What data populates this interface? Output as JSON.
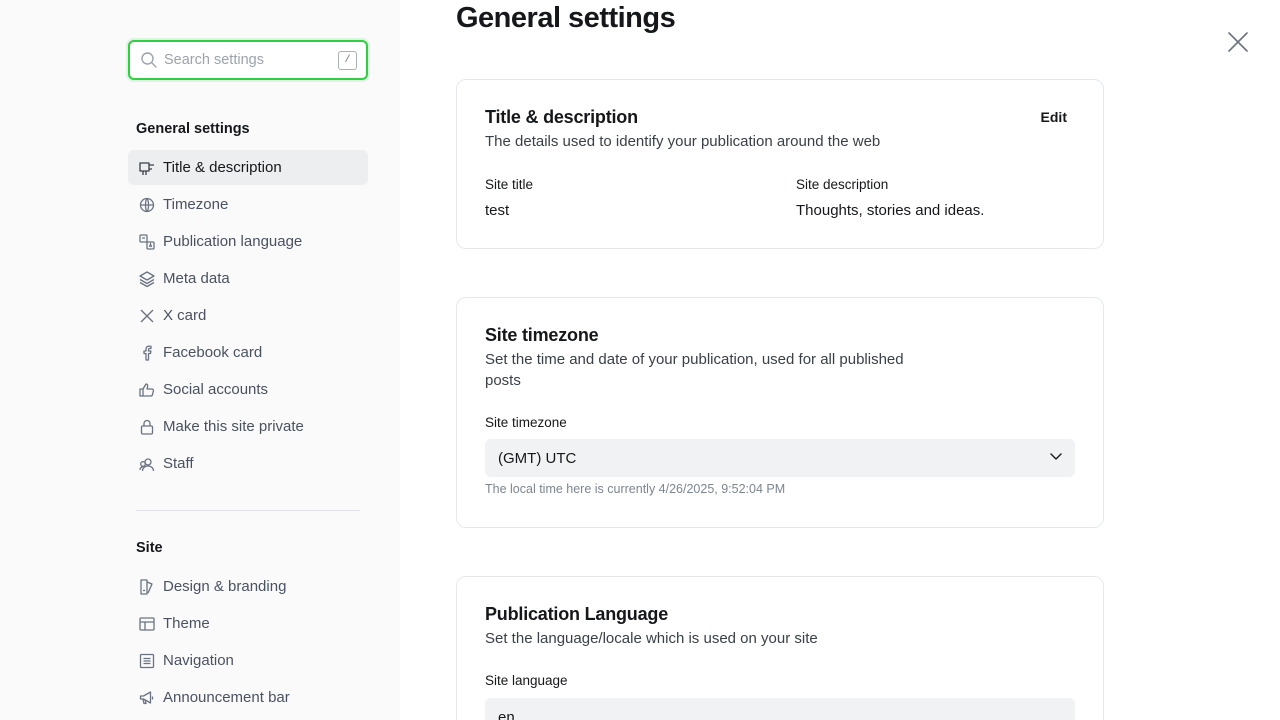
{
  "search": {
    "placeholder": "Search settings",
    "shortcut": "/"
  },
  "sidebar": {
    "general": {
      "title": "General settings",
      "items": [
        {
          "label": "Title & description",
          "icon": "title-icon",
          "active": true
        },
        {
          "label": "Timezone",
          "icon": "globe-icon"
        },
        {
          "label": "Publication language",
          "icon": "language-icon"
        },
        {
          "label": "Meta data",
          "icon": "layers-icon"
        },
        {
          "label": "X card",
          "icon": "x-logo-icon"
        },
        {
          "label": "Facebook card",
          "icon": "facebook-icon"
        },
        {
          "label": "Social accounts",
          "icon": "thumbs-up-icon"
        },
        {
          "label": "Make this site private",
          "icon": "lock-icon"
        },
        {
          "label": "Staff",
          "icon": "staff-icon"
        }
      ]
    },
    "site": {
      "title": "Site",
      "items": [
        {
          "label": "Design & branding",
          "icon": "brush-icon"
        },
        {
          "label": "Theme",
          "icon": "theme-icon"
        },
        {
          "label": "Navigation",
          "icon": "navigation-icon"
        },
        {
          "label": "Announcement bar",
          "icon": "megaphone-icon"
        }
      ]
    }
  },
  "main": {
    "title": "General settings",
    "title_card": {
      "title": "Title & description",
      "description": "The details used to identify your publication around the web",
      "edit_label": "Edit",
      "site_title_label": "Site title",
      "site_title_value": "test",
      "site_description_label": "Site description",
      "site_description_value": "Thoughts, stories and ideas."
    },
    "timezone_card": {
      "title": "Site timezone",
      "description_line1": "Set the time and date of your publication, used for all published",
      "description_line2": "posts",
      "field_label": "Site timezone",
      "selected": "(GMT) UTC",
      "hint": "The local time here is currently 4/26/2025, 9:52:04 PM"
    },
    "language_card": {
      "title": "Publication Language",
      "description": "Set the language/locale which is used on your site",
      "field_label": "Site language",
      "value": "en"
    }
  },
  "colors": {
    "accent_green": "#30cf43",
    "sidebar_bg": "#fafafb",
    "active_item_bg": "#eceef0",
    "card_border": "#e6e8eb"
  }
}
